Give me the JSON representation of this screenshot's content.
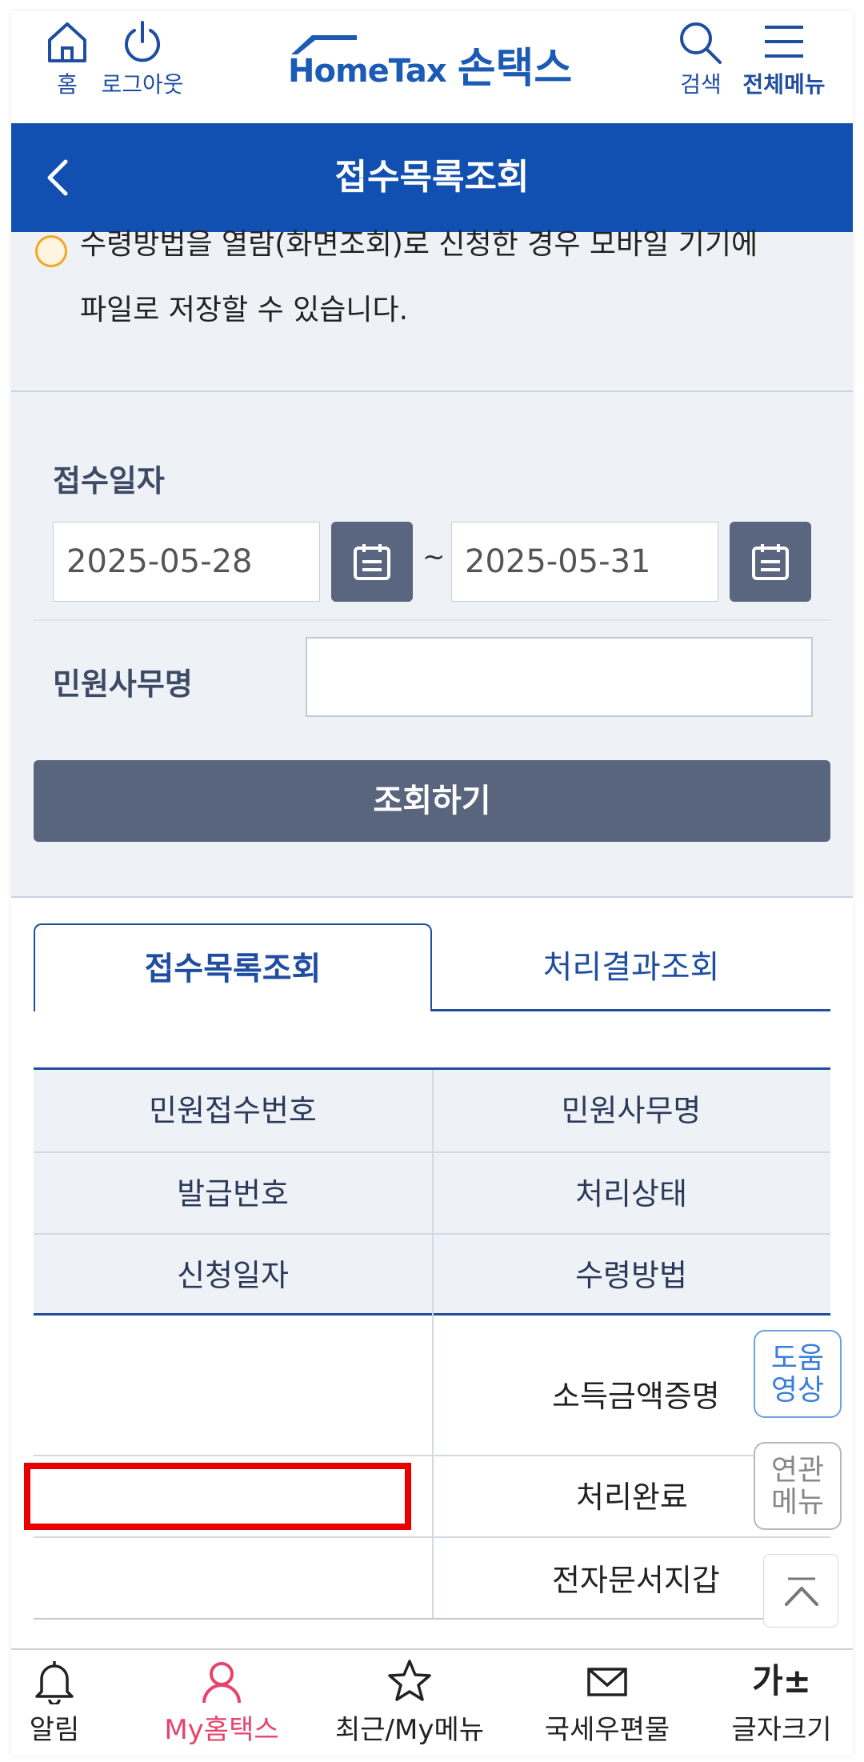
{
  "topbar": {
    "home_label": "홈",
    "logout_label": "로그아웃",
    "logo_text": "HomeTax",
    "logo_kor": "손택스",
    "search_label": "검색",
    "menu_label": "전체메뉴"
  },
  "page": {
    "title": "접수목록조회"
  },
  "notice": {
    "line1": "수령방법을 열람(화면조회)로 신청한 경우 모바일 기기에",
    "line2": "파일로 저장할 수 있습니다."
  },
  "search": {
    "date_label": "접수일자",
    "date_from": "2025-05-28",
    "date_to": "2025-05-31",
    "tilde": "~",
    "name_label": "민원사무명",
    "name_value": "",
    "submit_label": "조회하기"
  },
  "tabs": [
    {
      "label": "접수목록조회",
      "active": true
    },
    {
      "label": "처리결과조회",
      "active": false
    }
  ],
  "table": {
    "headers": [
      [
        "민원접수번호",
        "민원사무명"
      ],
      [
        "발급번호",
        "처리상태"
      ],
      [
        "신청일자",
        "수령방법"
      ]
    ],
    "row": {
      "receipt_no": "",
      "service_name": "소득금액증명",
      "issue_no": "",
      "status": "처리완료",
      "apply_date": "",
      "receive_method": "전자문서지갑"
    }
  },
  "floating": {
    "help_video": [
      "도움",
      "영상"
    ],
    "related_menu": [
      "연관",
      "메뉴"
    ]
  },
  "bottom_nav": [
    {
      "label": "알림",
      "icon": "bell-icon",
      "active": false
    },
    {
      "label": "My홈택스",
      "icon": "person-icon",
      "active": true
    },
    {
      "label": "최근/My메뉴",
      "icon": "star-icon",
      "active": false
    },
    {
      "label": "국세우편물",
      "icon": "mail-icon",
      "active": false
    },
    {
      "label": "글자크기",
      "icon": "font-size-icon",
      "active": false
    }
  ],
  "font_size_glyph": "가±",
  "colors": {
    "brand": "#1150b0",
    "accent": "#e5446b",
    "button": "#59647d"
  }
}
